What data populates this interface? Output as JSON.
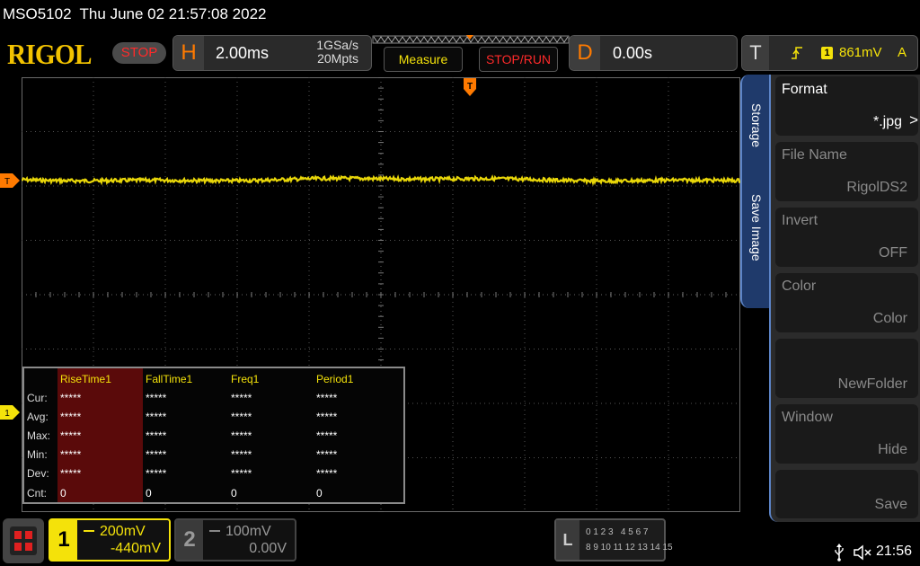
{
  "titlebar": {
    "model": "MSO5102",
    "datetime": "Thu June 02 21:57:08 2022"
  },
  "logo": "RIGOL",
  "run_state": "STOP",
  "horizontal": {
    "key": "H",
    "timebase": "2.00ms",
    "sample_rate": "1GSa/s",
    "memory_depth": "20Mpts"
  },
  "buttons": {
    "measure": "Measure",
    "stop_run": "STOP/RUN"
  },
  "delay": {
    "key": "D",
    "value": "0.00s"
  },
  "trigger": {
    "key": "T",
    "source": "1",
    "level": "861mV",
    "mode": "A"
  },
  "markers": {
    "trigger_left": "T",
    "trigger_top": "T",
    "ch1": "1"
  },
  "measure_table": {
    "headers": [
      "RiseTime1",
      "FallTime1",
      "Freq1",
      "Period1"
    ],
    "rows": [
      {
        "label": "Cur:",
        "values": [
          "*****",
          "*****",
          "*****",
          "*****"
        ]
      },
      {
        "label": "Avg:",
        "values": [
          "*****",
          "*****",
          "*****",
          "*****"
        ]
      },
      {
        "label": "Max:",
        "values": [
          "*****",
          "*****",
          "*****",
          "*****"
        ]
      },
      {
        "label": "Min:",
        "values": [
          "*****",
          "*****",
          "*****",
          "*****"
        ]
      },
      {
        "label": "Dev:",
        "values": [
          "*****",
          "*****",
          "*****",
          "*****"
        ]
      },
      {
        "label": "Cnt:",
        "values": [
          "0",
          "0",
          "0",
          "0"
        ]
      }
    ]
  },
  "side_tabs": {
    "storage": "Storage",
    "save_image": "Save Image"
  },
  "menu": {
    "format": {
      "title": "Format",
      "value": "*.jpg",
      "chevron": ">"
    },
    "file_name": {
      "title": "File Name",
      "value": "RigolDS2"
    },
    "invert": {
      "title": "Invert",
      "value": "OFF"
    },
    "color": {
      "title": "Color",
      "value": "Color"
    },
    "new_folder": {
      "title": "",
      "value": "NewFolder"
    },
    "window": {
      "title": "Window",
      "value": "Hide"
    },
    "save": {
      "title": "",
      "value": "Save"
    }
  },
  "channels": {
    "ch1": {
      "number": "1",
      "scale": "200mV",
      "offset": "-440mV"
    },
    "ch2": {
      "number": "2",
      "scale": "100mV",
      "offset": "0.00V"
    }
  },
  "la": {
    "key": "L",
    "row1": "0 1 2 3   4 5 6 7",
    "row2": "8 9 10 11 12 13 14 15"
  },
  "status": {
    "clock": "21:56"
  },
  "colors": {
    "ch1": "#f4e20a",
    "accent_orange": "#ff7a00",
    "stop_red": "#ff2a2a",
    "menu_blue": "#1f3a6b"
  },
  "icons": [
    "menu-grid-icon",
    "usb-icon",
    "speaker-muted-icon",
    "trigger-edge-icon",
    "trigger-marker-icon"
  ]
}
